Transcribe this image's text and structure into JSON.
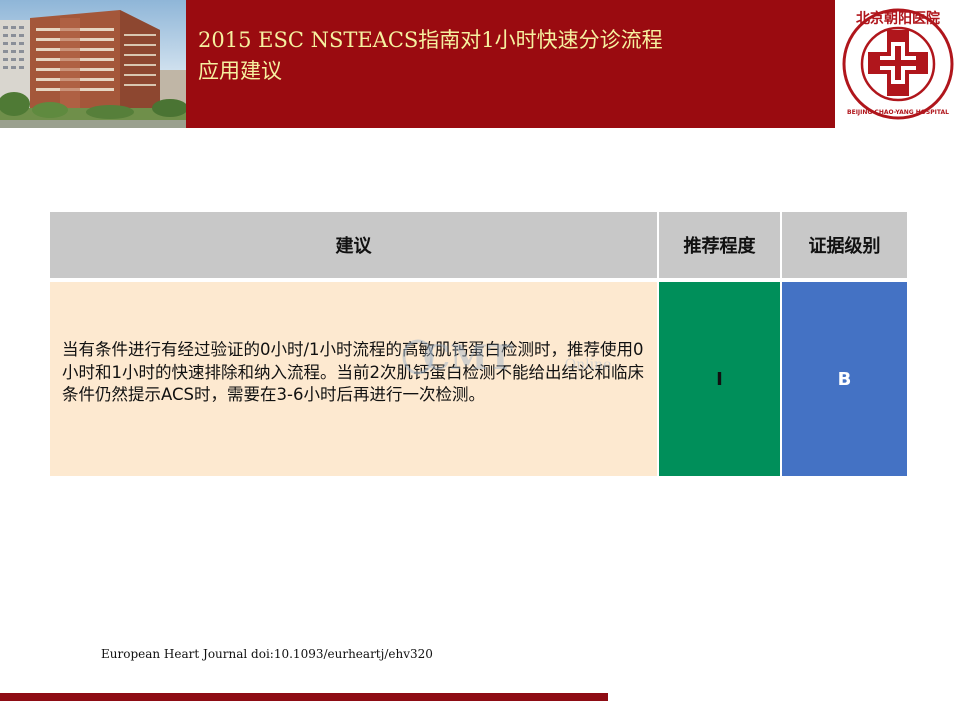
{
  "header": {
    "title": "2015 ESC NSTEACS指南对1小时快速分诊流程\n 应用建议",
    "logo_text": "北京朝阳医院",
    "logo_subtext": "BEIJING CHAO-YANG HOSPITAL"
  },
  "table": {
    "headers": {
      "recommendation": "建议",
      "class": "推荐程度",
      "level": "证据级别"
    },
    "row": {
      "recommendation": "当有条件进行有经过验证的0小时/1小时流程的高敏肌钙蛋白检测时，推荐使用0小时和1小时的快速排除和纳入流程。当前2次肌钙蛋白检测不能给出结论和临床条件仍然提示ACS时，需要在3-6小时后再进行一次检测。",
      "class": "I",
      "level": "B"
    },
    "colors": {
      "class_cell": "#008f5a",
      "level_cell": "#4472c4"
    }
  },
  "watermark": {
    "text": "CMT",
    "subtext": "Online"
  },
  "reference": "European Heart Journal doi:10.1093/eurheartj/ehv320",
  "colors": {
    "banner": "#9a0b10",
    "title": "#f6f1a0",
    "header_row": "#c8c8c8",
    "text_cell": "#fde9d0"
  }
}
